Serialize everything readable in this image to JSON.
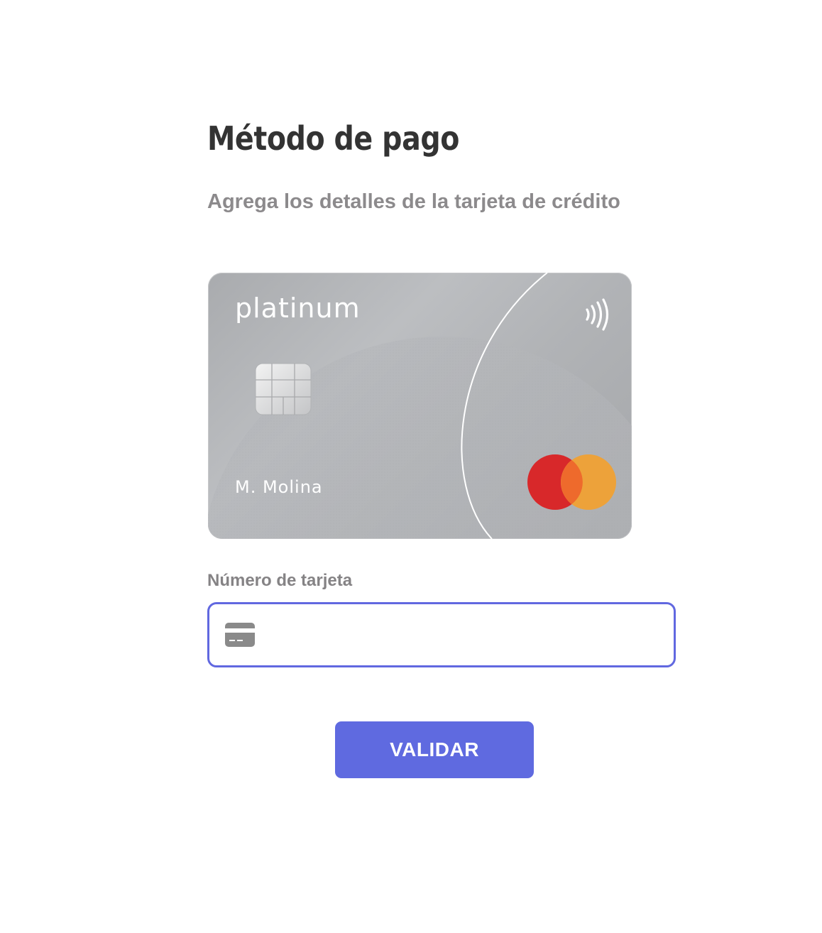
{
  "header": {
    "title": "Método de pago",
    "subtitle": "Agrega los detalles de la tarjeta de crédito"
  },
  "card": {
    "brand_text": "platinum",
    "holder_name": "M. Molina",
    "network": "mastercard",
    "icons": [
      "chip-icon",
      "contactless-icon",
      "mastercard-logo"
    ],
    "colors": {
      "mastercard_red": "#d8282a",
      "mastercard_orange": "#eda23a",
      "mastercard_overlap": "#ee6a2c"
    }
  },
  "form": {
    "card_number_label": "Número de tarjeta",
    "card_number_value": "",
    "card_number_icon": "credit-card-icon",
    "submit_label": "VALIDAR"
  },
  "theme": {
    "accent": "#5f6ae0",
    "title_color": "#333333",
    "muted_text": "#8c8a8c"
  }
}
